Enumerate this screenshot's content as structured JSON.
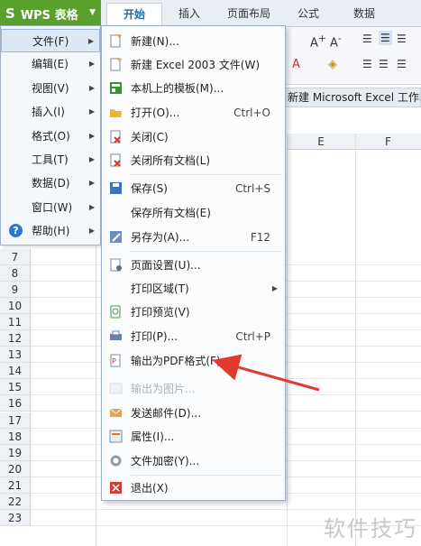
{
  "app": {
    "name": "WPS 表格"
  },
  "ribbon_tabs": [
    {
      "label": "开始",
      "active": true
    },
    {
      "label": "插入"
    },
    {
      "label": "页面布局"
    },
    {
      "label": "公式"
    },
    {
      "label": "数据"
    }
  ],
  "formula_bar_fragment": "新建 Microsoft Excel 工作表",
  "columns": [
    "E",
    "F"
  ],
  "rows": [
    "7",
    "8",
    "9",
    "10",
    "11",
    "12",
    "13",
    "14",
    "15",
    "16",
    "17",
    "18",
    "19",
    "20",
    "21",
    "22",
    "23"
  ],
  "left_menu": [
    {
      "label": "文件(F)",
      "has_submenu": true,
      "active": true
    },
    {
      "label": "编辑(E)",
      "has_submenu": true
    },
    {
      "label": "视图(V)",
      "has_submenu": true
    },
    {
      "label": "插入(I)",
      "has_submenu": true
    },
    {
      "label": "格式(O)",
      "has_submenu": true
    },
    {
      "label": "工具(T)",
      "has_submenu": true
    },
    {
      "label": "数据(D)",
      "has_submenu": true
    },
    {
      "label": "窗口(W)",
      "has_submenu": true
    },
    {
      "label": "帮助(H)",
      "has_submenu": true,
      "icon": "help-icon"
    }
  ],
  "file_menu": [
    {
      "label": "新建(N)...",
      "icon": "new-file-icon"
    },
    {
      "label": "新建 Excel 2003 文件(W)",
      "icon": "new-excel-icon"
    },
    {
      "label": "本机上的模板(M)...",
      "icon": "template-icon"
    },
    {
      "label": "打开(O)...",
      "shortcut": "Ctrl+O",
      "icon": "open-folder-icon"
    },
    {
      "label": "关闭(C)",
      "icon": "close-doc-icon"
    },
    {
      "label": "关闭所有文档(L)",
      "icon": "close-all-icon",
      "separator_after": true
    },
    {
      "label": "保存(S)",
      "shortcut": "Ctrl+S",
      "icon": "save-icon"
    },
    {
      "label": "保存所有文档(E)",
      "icon": ""
    },
    {
      "label": "另存为(A)...",
      "shortcut": "F12",
      "icon": "save-as-icon",
      "separator_after": true
    },
    {
      "label": "页面设置(U)...",
      "icon": "page-setup-icon"
    },
    {
      "label": "打印区域(T)",
      "has_submenu": true,
      "icon": ""
    },
    {
      "label": "打印预览(V)",
      "icon": "print-preview-icon"
    },
    {
      "label": "打印(P)...",
      "shortcut": "Ctrl+P",
      "icon": "printer-icon"
    },
    {
      "label": "输出为PDF格式(F)...",
      "icon": "pdf-icon"
    },
    {
      "label": "输出为图片...",
      "icon": "image-icon",
      "disabled": true
    },
    {
      "label": "发送邮件(D)...",
      "icon": "mail-icon"
    },
    {
      "label": "属性(I)...",
      "icon": "properties-icon"
    },
    {
      "label": "文件加密(Y)...",
      "icon": "encrypt-icon",
      "separator_after": true
    },
    {
      "label": "退出(X)",
      "icon": "exit-icon"
    }
  ],
  "watermark": "软件技巧",
  "colors": {
    "accent_green": "#5aa02c",
    "arrow_red": "#e23a2e",
    "menu_border": "#9fb1c6"
  }
}
